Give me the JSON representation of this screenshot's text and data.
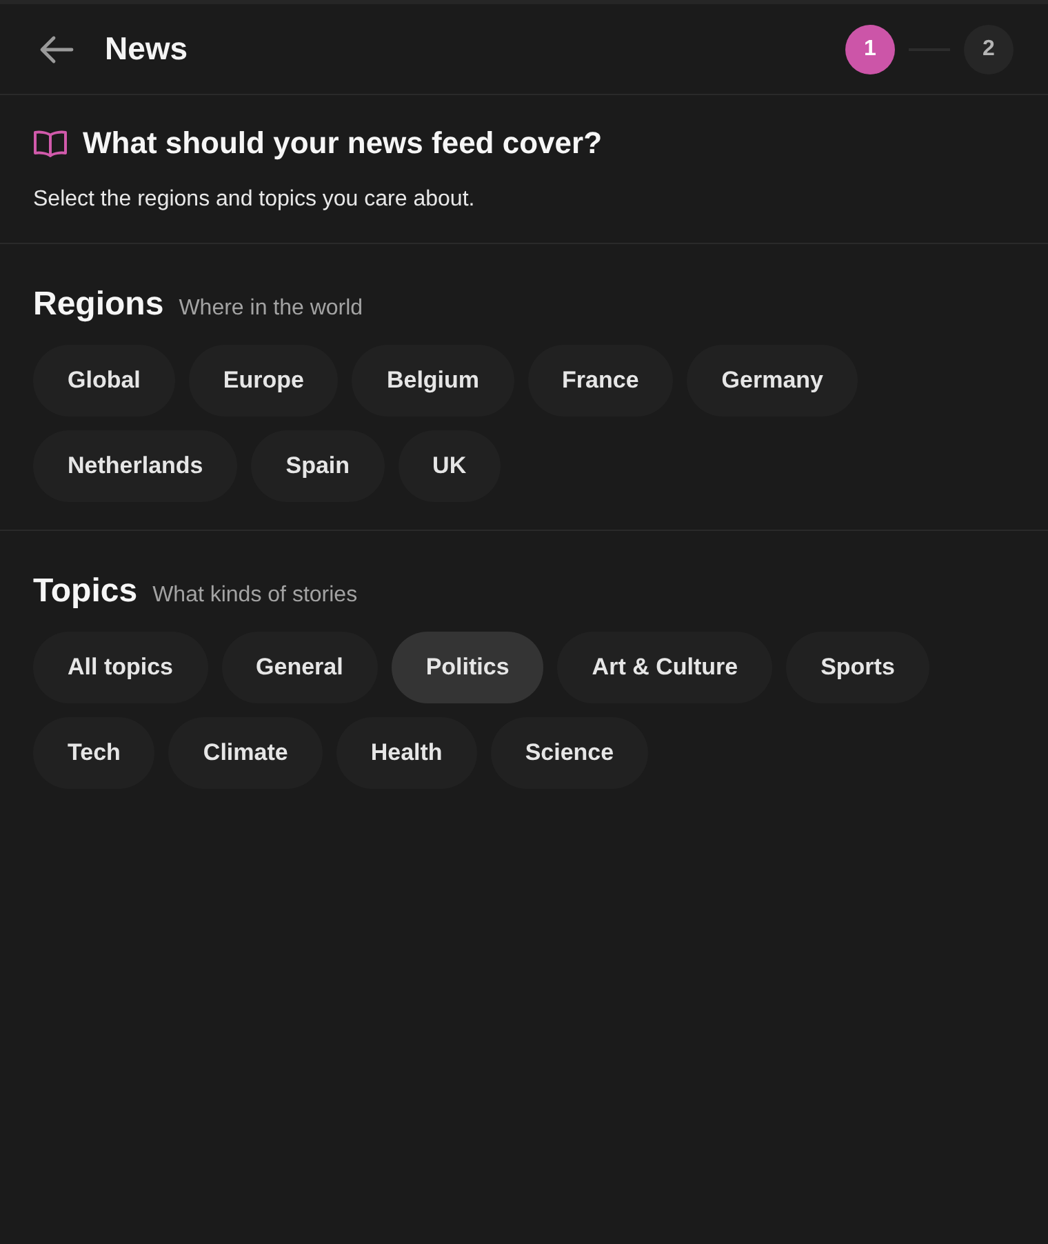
{
  "header": {
    "title": "News",
    "steps": [
      {
        "label": "1",
        "selected": true
      },
      {
        "label": "2",
        "selected": false
      }
    ]
  },
  "intro": {
    "heading": "What should your news feed cover?",
    "subtitle": "Select the regions and topics you care about."
  },
  "sections": [
    {
      "title": "Regions",
      "hint": "Where in the world",
      "chips": [
        {
          "label": "Global",
          "selected": false,
          "hovered": false
        },
        {
          "label": "Europe",
          "selected": false,
          "hovered": false
        },
        {
          "label": "Belgium",
          "selected": false,
          "hovered": false
        },
        {
          "label": "France",
          "selected": false,
          "hovered": false
        },
        {
          "label": "Germany",
          "selected": false,
          "hovered": false
        },
        {
          "label": "Netherlands",
          "selected": false,
          "hovered": false
        },
        {
          "label": "Spain",
          "selected": false,
          "hovered": false
        },
        {
          "label": "UK",
          "selected": false,
          "hovered": false
        }
      ]
    },
    {
      "title": "Topics",
      "hint": "What kinds of stories",
      "chips": [
        {
          "label": "All topics",
          "selected": false,
          "hovered": false
        },
        {
          "label": "General",
          "selected": false,
          "hovered": false
        },
        {
          "label": "Politics",
          "selected": false,
          "hovered": true
        },
        {
          "label": "Art & Culture",
          "selected": false,
          "hovered": false
        },
        {
          "label": "Sports",
          "selected": false,
          "hovered": false
        },
        {
          "label": "Tech",
          "selected": false,
          "hovered": false
        },
        {
          "label": "Climate",
          "selected": false,
          "hovered": false
        },
        {
          "label": "Health",
          "selected": false,
          "hovered": false
        },
        {
          "label": "Science",
          "selected": false,
          "hovered": false
        }
      ]
    }
  ]
}
